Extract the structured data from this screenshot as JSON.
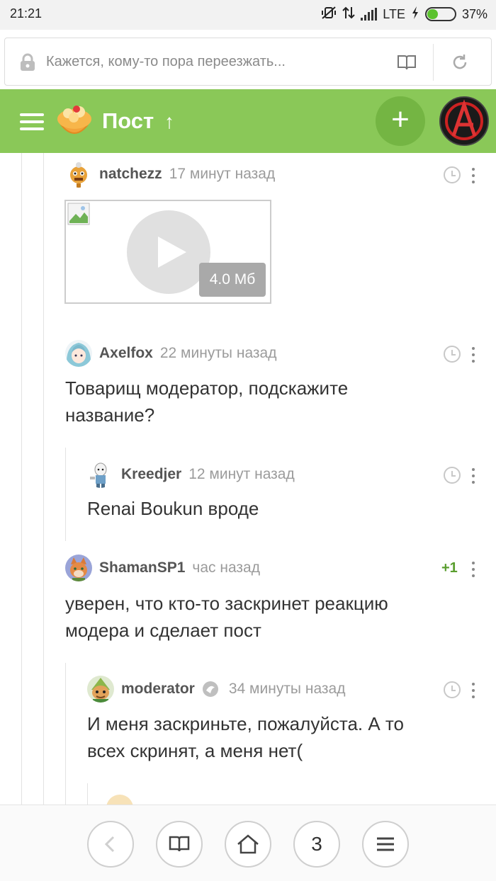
{
  "status_bar": {
    "time": "21:21",
    "network": "LTE",
    "battery_percent": "37%",
    "battery_level": 0.37,
    "icons": [
      "muted-vibrate-icon",
      "data-transfer-icon",
      "signal-icon",
      "charging-icon",
      "battery-icon"
    ]
  },
  "url_bar": {
    "text": "Кажется, кому-то пора переезжать...",
    "icons": [
      "lock-icon",
      "reader-book-icon",
      "reload-icon"
    ]
  },
  "app_bar": {
    "title": "Пост",
    "up_symbol": "↑",
    "add_symbol": "+",
    "colors": {
      "bar": "#8ac858",
      "add_button": "#74b543"
    }
  },
  "comments": [
    {
      "author": "natchezz",
      "time": "17 минут назад",
      "video_size": "4.0 Мб"
    },
    {
      "author": "Axelfox",
      "time": "22 минуты назад",
      "text": [
        "Товарищ модератор, подскажите",
        "название?"
      ]
    },
    {
      "author": "Kreedjer",
      "time": "12 минут назад",
      "text": [
        "Renai Boukun вроде"
      ]
    },
    {
      "author": "ShamanSP1",
      "time": "час назад",
      "rating": "+1",
      "text": [
        "уверен, что кто-то заскринет реакцию",
        "модера и сделает пост"
      ]
    },
    {
      "author": "moderator",
      "time": "34 минуты назад",
      "text": [
        "И меня заскриньте, пожалуйста. А то",
        "всех скринят, а меня нет("
      ]
    }
  ],
  "bottom_nav": {
    "tab_count": "3",
    "buttons": [
      "back-button",
      "reader-button",
      "home-button",
      "tabs-button",
      "menu-button"
    ]
  }
}
